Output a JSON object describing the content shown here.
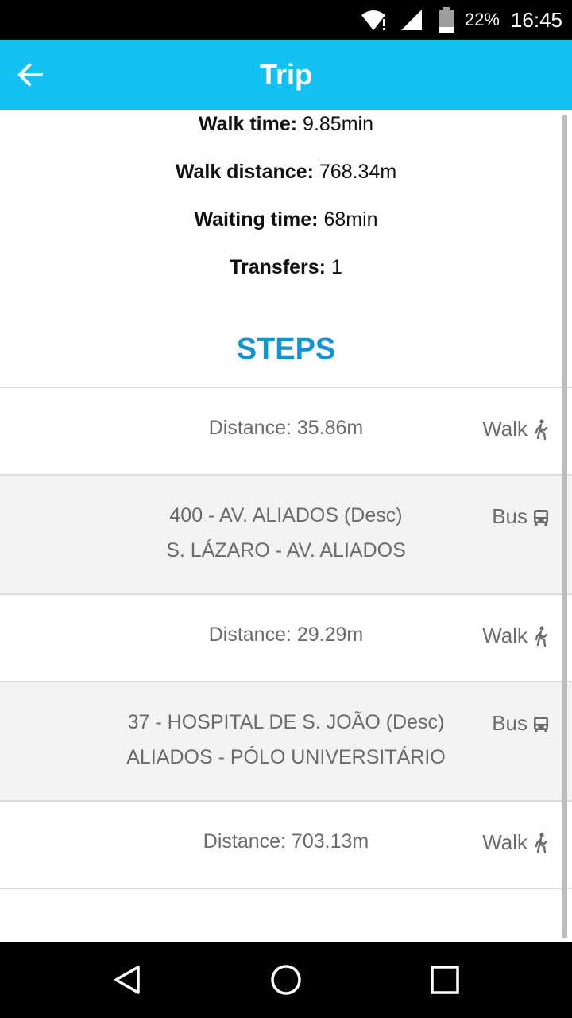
{
  "status_bar": {
    "battery_percent": "22%",
    "time": "16:45",
    "icons": [
      "wifi-alert-icon",
      "signal-icon",
      "battery-icon"
    ]
  },
  "app_bar": {
    "title": "Trip",
    "back_icon": "arrow-left-icon",
    "color": "#12c0f2"
  },
  "summary": {
    "walk_time": {
      "label": "Walk time:",
      "value": "9.85min"
    },
    "walk_distance": {
      "label": "Walk distance:",
      "value": "768.34m"
    },
    "waiting_time": {
      "label": "Waiting time:",
      "value": "68min"
    },
    "transfers": {
      "label": "Transfers:",
      "value": "1"
    }
  },
  "steps_heading": "STEPS",
  "steps": [
    {
      "line1": "Distance: 35.86m",
      "mode": "Walk",
      "icon": "walk-icon"
    },
    {
      "line1": "400 - AV. ALIADOS (Desc)",
      "line2": "S. LÁZARO - AV. ALIADOS",
      "mode": "Bus",
      "icon": "bus-icon"
    },
    {
      "line1": "Distance: 29.29m",
      "mode": "Walk",
      "icon": "walk-icon"
    },
    {
      "line1": "37 - HOSPITAL DE S. JOÃO (Desc)",
      "line2": "ALIADOS - PÓLO UNIVERSITÁRIO",
      "mode": "Bus",
      "icon": "bus-icon"
    },
    {
      "line1": "Distance: 703.13m",
      "mode": "Walk",
      "icon": "walk-icon"
    }
  ],
  "nav_bar": {
    "icons": [
      "back-triangle-icon",
      "home-circle-icon",
      "recents-square-icon"
    ]
  },
  "colors": {
    "accent": "#1692d0",
    "step_text": "#6b6b6b",
    "alt_row": "#f3f3f3"
  }
}
